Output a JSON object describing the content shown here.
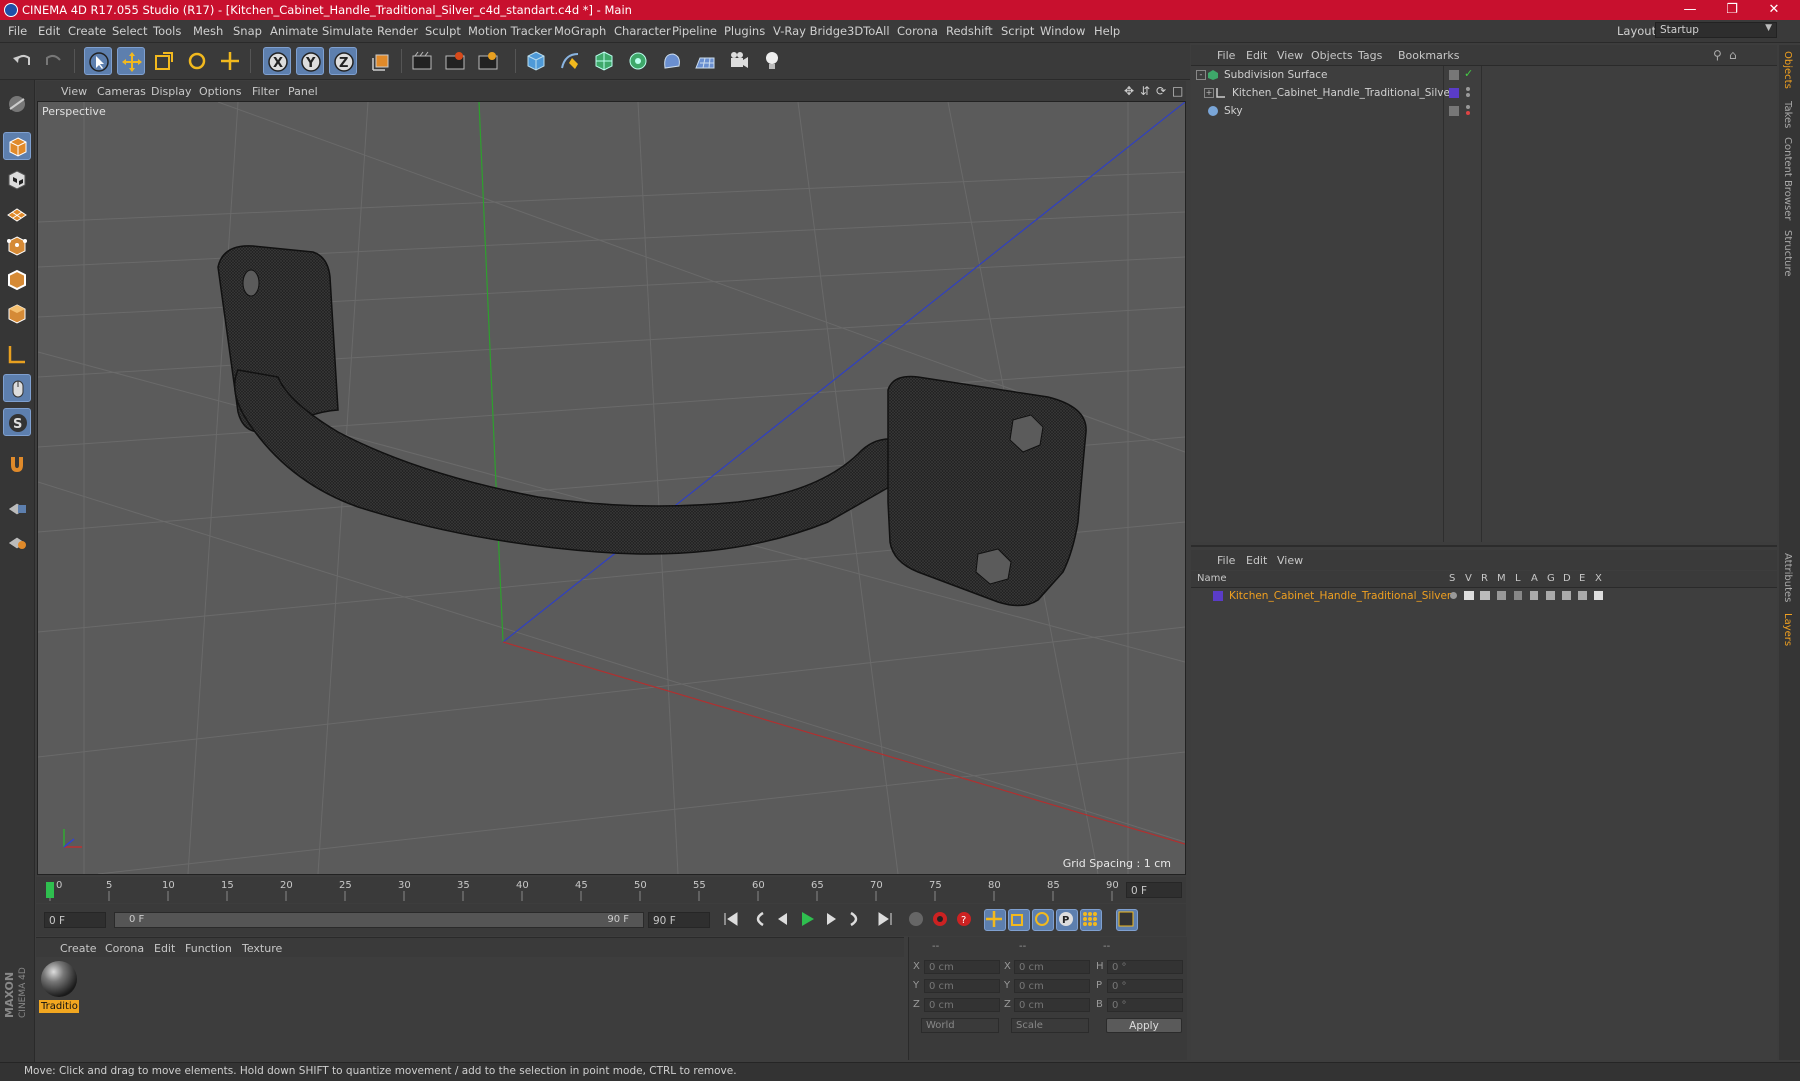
{
  "window": {
    "title": "CINEMA 4D R17.055 Studio (R17) - [Kitchen_Cabinet_Handle_Traditional_Silver_c4d_standart.c4d *] - Main",
    "layout_label": "Layout:",
    "layout_value": "Startup"
  },
  "menubar": [
    "File",
    "Edit",
    "Create",
    "Select",
    "Tools",
    "Mesh",
    "Snap",
    "Animate",
    "Simulate",
    "Render",
    "Sculpt",
    "Motion Tracker",
    "MoGraph",
    "Character",
    "Pipeline",
    "Plugins",
    "V-Ray Bridge",
    "3DToAll",
    "Corona",
    "Redshift",
    "Script",
    "Window",
    "Help"
  ],
  "viewport": {
    "menus": [
      "View",
      "Cameras",
      "Display",
      "Options",
      "Filter",
      "Panel"
    ],
    "camera_label": "Perspective",
    "grid_spacing": "Grid Spacing : 1 cm"
  },
  "timeline": {
    "ticks": [
      "0",
      "5",
      "10",
      "15",
      "20",
      "25",
      "30",
      "35",
      "40",
      "45",
      "50",
      "55",
      "60",
      "65",
      "70",
      "75",
      "80",
      "85",
      "90"
    ],
    "current_frame": "0 F",
    "start_field": "0 F",
    "range_start": "0 F",
    "range_end": "90 F",
    "end_field": "90 F"
  },
  "materials": {
    "menus": [
      "Create",
      "Corona",
      "Edit",
      "Function",
      "Texture"
    ],
    "items": [
      {
        "label": "Traditio"
      }
    ]
  },
  "coords": {
    "headers": [
      "--",
      "--",
      "--"
    ],
    "rows": [
      {
        "a": "X",
        "av": "0 cm",
        "b": "X",
        "bv": "0 cm",
        "c": "H",
        "cv": "0 °"
      },
      {
        "a": "Y",
        "av": "0 cm",
        "b": "Y",
        "bv": "0 cm",
        "c": "P",
        "cv": "0 °"
      },
      {
        "a": "Z",
        "av": "0 cm",
        "b": "Z",
        "bv": "0 cm",
        "c": "B",
        "cv": "0 °"
      }
    ],
    "world": "World",
    "scale": "Scale",
    "apply": "Apply"
  },
  "objects_panel": {
    "menus": [
      "File",
      "Edit",
      "View",
      "Objects",
      "Tags",
      "Bookmarks"
    ],
    "items": [
      {
        "name": "Subdivision Surface"
      },
      {
        "name": "Kitchen_Cabinet_Handle_Traditional_Silver"
      },
      {
        "name": "Sky"
      }
    ]
  },
  "layers_panel": {
    "menus": [
      "File",
      "Edit",
      "View"
    ],
    "name_col": "Name",
    "cols": [
      "S",
      "V",
      "R",
      "M",
      "L",
      "A",
      "G",
      "D",
      "E",
      "X"
    ],
    "items": [
      {
        "name": "Kitchen_Cabinet_Handle_Traditional_Silver"
      }
    ]
  },
  "right_tabs": [
    "Objects",
    "Takes",
    "Content Browser",
    "Structure",
    "Attributes",
    "Layers"
  ],
  "status": "Move: Click and drag to move elements. Hold down SHIFT to quantize movement / add to the selection in point mode, CTRL to remove.",
  "colors": {
    "titlebar": "#c8102e",
    "accent": "#5d7fae",
    "layer_name": "#f0a020",
    "x_axis": "#b03030",
    "y_axis": "#30a030",
    "z_axis": "#3040c0"
  },
  "maxon_logo": "MAXON CINEMA 4D"
}
